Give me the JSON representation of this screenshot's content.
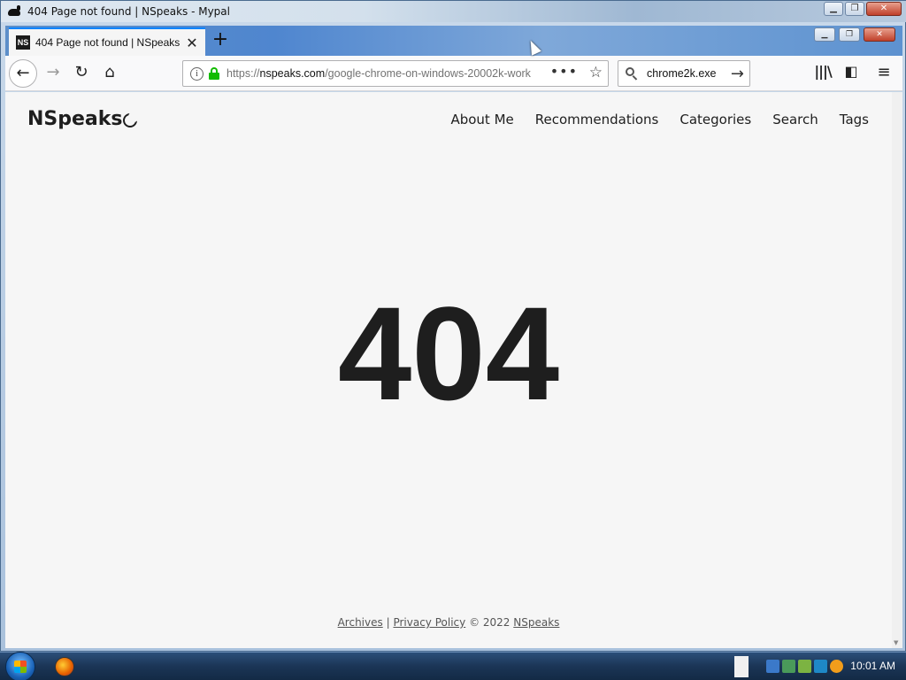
{
  "os_window": {
    "title": "404 Page not found | NSpeaks - Mypal",
    "minimize": "▁",
    "restore": "❐",
    "close": "✕"
  },
  "browser": {
    "tab": {
      "favicon_text": "NS",
      "title": "404 Page not found | NSpeaks",
      "close": "✕"
    },
    "new_tab": "+",
    "url": {
      "prefix": "https://",
      "host": "nspeaks.com",
      "path": "/google-chrome-on-windows-20002k-work"
    },
    "search": {
      "value": "chrome2k.exe"
    },
    "icons": {
      "back": "←",
      "forward": "→",
      "reload": "↻",
      "home": "⌂",
      "more": "•••",
      "star": "☆",
      "search_go": "→",
      "library": "|||\\",
      "sidebar": "◧",
      "menu": "≡"
    }
  },
  "site": {
    "logo": "NSpeaks",
    "nav": [
      "About Me",
      "Recommendations",
      "Categories",
      "Search",
      "Tags"
    ],
    "error_code": "404",
    "footer": {
      "archives": "Archives",
      "sep": "|",
      "privacy": "Privacy Policy",
      "copyright": "© 2022",
      "brand": "NSpeaks"
    }
  },
  "taskbar": {
    "clock": "10:01 AM"
  }
}
